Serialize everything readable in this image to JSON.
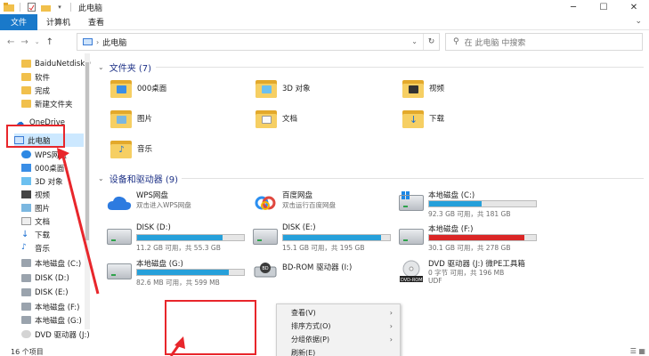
{
  "window": {
    "title": "此电脑"
  },
  "ribbon": {
    "tabs": [
      "文件",
      "计算机",
      "查看"
    ]
  },
  "address": {
    "path": "此电脑",
    "search_placeholder": "在 此电脑 中搜索"
  },
  "sidebar": {
    "items": [
      {
        "label": "BaiduNetdiskD",
        "icon": "folder-icon"
      },
      {
        "label": "软件",
        "icon": "folder-icon"
      },
      {
        "label": "完成",
        "icon": "folder-icon"
      },
      {
        "label": "新建文件夹",
        "icon": "folder-icon"
      },
      {
        "label": "OneDrive",
        "icon": "cloud-icon"
      },
      {
        "label": "此电脑",
        "icon": "computer-icon",
        "selected": true
      },
      {
        "label": "WPS网盘",
        "icon": "cloud-icon"
      },
      {
        "label": "000桌面",
        "icon": "desktop-icon"
      },
      {
        "label": "3D 对象",
        "icon": "cube-icon"
      },
      {
        "label": "视频",
        "icon": "video-icon"
      },
      {
        "label": "图片",
        "icon": "picture-icon"
      },
      {
        "label": "文档",
        "icon": "document-icon"
      },
      {
        "label": "下载",
        "icon": "download-icon"
      },
      {
        "label": "音乐",
        "icon": "music-icon"
      },
      {
        "label": "本地磁盘 (C:)",
        "icon": "drive-icon"
      },
      {
        "label": "DISK (D:)",
        "icon": "drive-icon"
      },
      {
        "label": "DISK (E:)",
        "icon": "drive-icon"
      },
      {
        "label": "本地磁盘 (F:)",
        "icon": "drive-icon"
      },
      {
        "label": "本地磁盘 (G:)",
        "icon": "drive-icon"
      },
      {
        "label": "DVD 驱动器 (J:)",
        "icon": "disc-icon"
      }
    ]
  },
  "folders": {
    "header": "文件夹 (7)",
    "items": [
      {
        "label": "000桌面",
        "icon": "desktop-folder-icon"
      },
      {
        "label": "3D 对象",
        "icon": "3d-folder-icon"
      },
      {
        "label": "视频",
        "icon": "video-folder-icon"
      },
      {
        "label": "图片",
        "icon": "picture-folder-icon"
      },
      {
        "label": "文档",
        "icon": "document-folder-icon"
      },
      {
        "label": "下载",
        "icon": "download-folder-icon"
      },
      {
        "label": "音乐",
        "icon": "music-folder-icon"
      }
    ]
  },
  "devices": {
    "header": "设备和驱动器 (9)",
    "items": [
      {
        "name": "WPS网盘",
        "sub": "双击进入WPS网盘",
        "icon": "wps-cloud-icon"
      },
      {
        "name": "百度网盘",
        "sub": "双击运行百度网盘",
        "icon": "baidu-cloud-icon"
      },
      {
        "name": "本地磁盘 (C:)",
        "sub": "92.3 GB 可用，共 181 GB",
        "used": 0.49,
        "icon": "windows-drive-icon"
      },
      {
        "name": "DISK (D:)",
        "sub": "11.2 GB 可用，共 55.3 GB",
        "used": 0.8,
        "icon": "drive-icon"
      },
      {
        "name": "DISK (E:)",
        "sub": "15.1 GB 可用，共 195 GB",
        "used": 0.92,
        "icon": "drive-icon"
      },
      {
        "name": "本地磁盘 (F:)",
        "sub": "30.1 GB 可用，共 278 GB",
        "used": 0.89,
        "warning": true,
        "icon": "drive-icon"
      },
      {
        "name": "本地磁盘 (G:)",
        "sub": "82.6 MB 可用，共 599 MB",
        "used": 0.86,
        "icon": "drive-icon"
      },
      {
        "name": "BD-ROM 驱动器 (I:)",
        "sub": "",
        "icon": "bd-rom-icon"
      },
      {
        "name": "DVD 驱动器 (J:) 微PE工具箱",
        "sub": "0 字节 可用，共 196 MB",
        "sub2": "UDF",
        "icon": "dvd-icon",
        "icon_text": "DVD-ROM"
      }
    ]
  },
  "context_menu": {
    "items": [
      {
        "label": "查看(V)",
        "submenu": true
      },
      {
        "label": "排序方式(O)",
        "submenu": true
      },
      {
        "label": "分组依据(P)",
        "submenu": true
      },
      {
        "label": "刷新(E)",
        "submenu": false
      }
    ]
  },
  "status": {
    "count": "16 个项目"
  },
  "colors": {
    "accent": "#1979ca",
    "bar": "#26a0da",
    "bar_warning": "#da2626",
    "annotation": "#e8262b",
    "header": "#1e3287"
  }
}
